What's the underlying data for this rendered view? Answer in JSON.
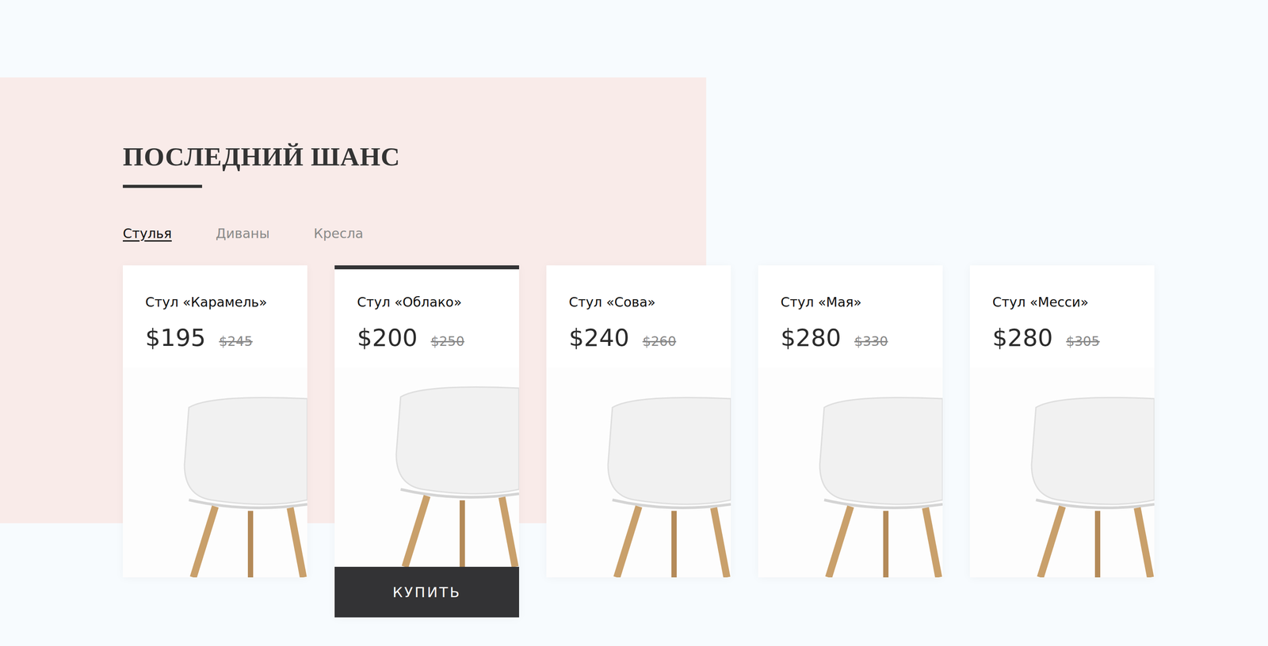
{
  "section": {
    "title": "ПОСЛЕДНИЙ ШАНС"
  },
  "tabs": [
    {
      "label": "Стулья",
      "selected": true
    },
    {
      "label": "Диваны",
      "selected": false
    },
    {
      "label": "Кресла",
      "selected": false
    }
  ],
  "products": [
    {
      "name": "Стул «Карамель»",
      "price": "$195",
      "old_price": "$245",
      "selected": false
    },
    {
      "name": "Стул «Облако»",
      "price": "$200",
      "old_price": "$250",
      "selected": true
    },
    {
      "name": "Стул «Сова»",
      "price": "$240",
      "old_price": "$260",
      "selected": false
    },
    {
      "name": "Стул «Мая»",
      "price": "$280",
      "old_price": "$330",
      "selected": false
    },
    {
      "name": "Стул «Месси»",
      "price": "$280",
      "old_price": "$305",
      "selected": false
    }
  ],
  "buy_button": "КУПИТЬ"
}
